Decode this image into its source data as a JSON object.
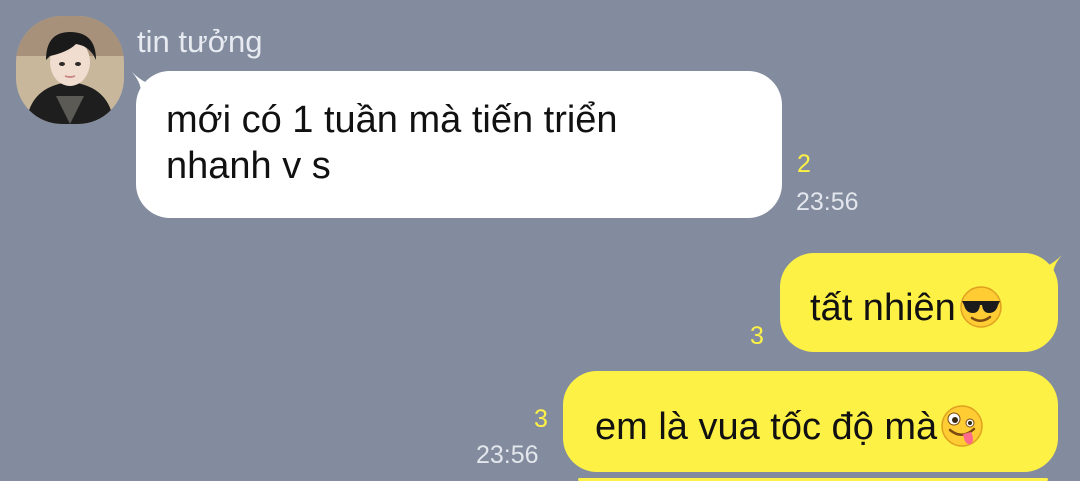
{
  "chat": {
    "incoming": {
      "sender_name": "tin tưởng",
      "avatar_icon": "profile-photo-icon",
      "message_line1": "mới có 1 tuần mà tiến triển",
      "message_line2": "nhanh v s",
      "unread_count": "2",
      "time": "23:56"
    },
    "outgoing": [
      {
        "text": "tất nhiên",
        "emoji_icon": "sunglasses-face-icon",
        "unread_count": "3"
      },
      {
        "text": "em là vua tốc độ mà",
        "emoji_icon": "zany-face-icon",
        "unread_count": "3",
        "time": "23:56"
      }
    ]
  },
  "colors": {
    "background": "#828c9e",
    "incoming_bubble": "#ffffff",
    "outgoing_bubble": "#fef146",
    "unread_count": "#fef146",
    "timestamp": "#e3e6ec"
  }
}
